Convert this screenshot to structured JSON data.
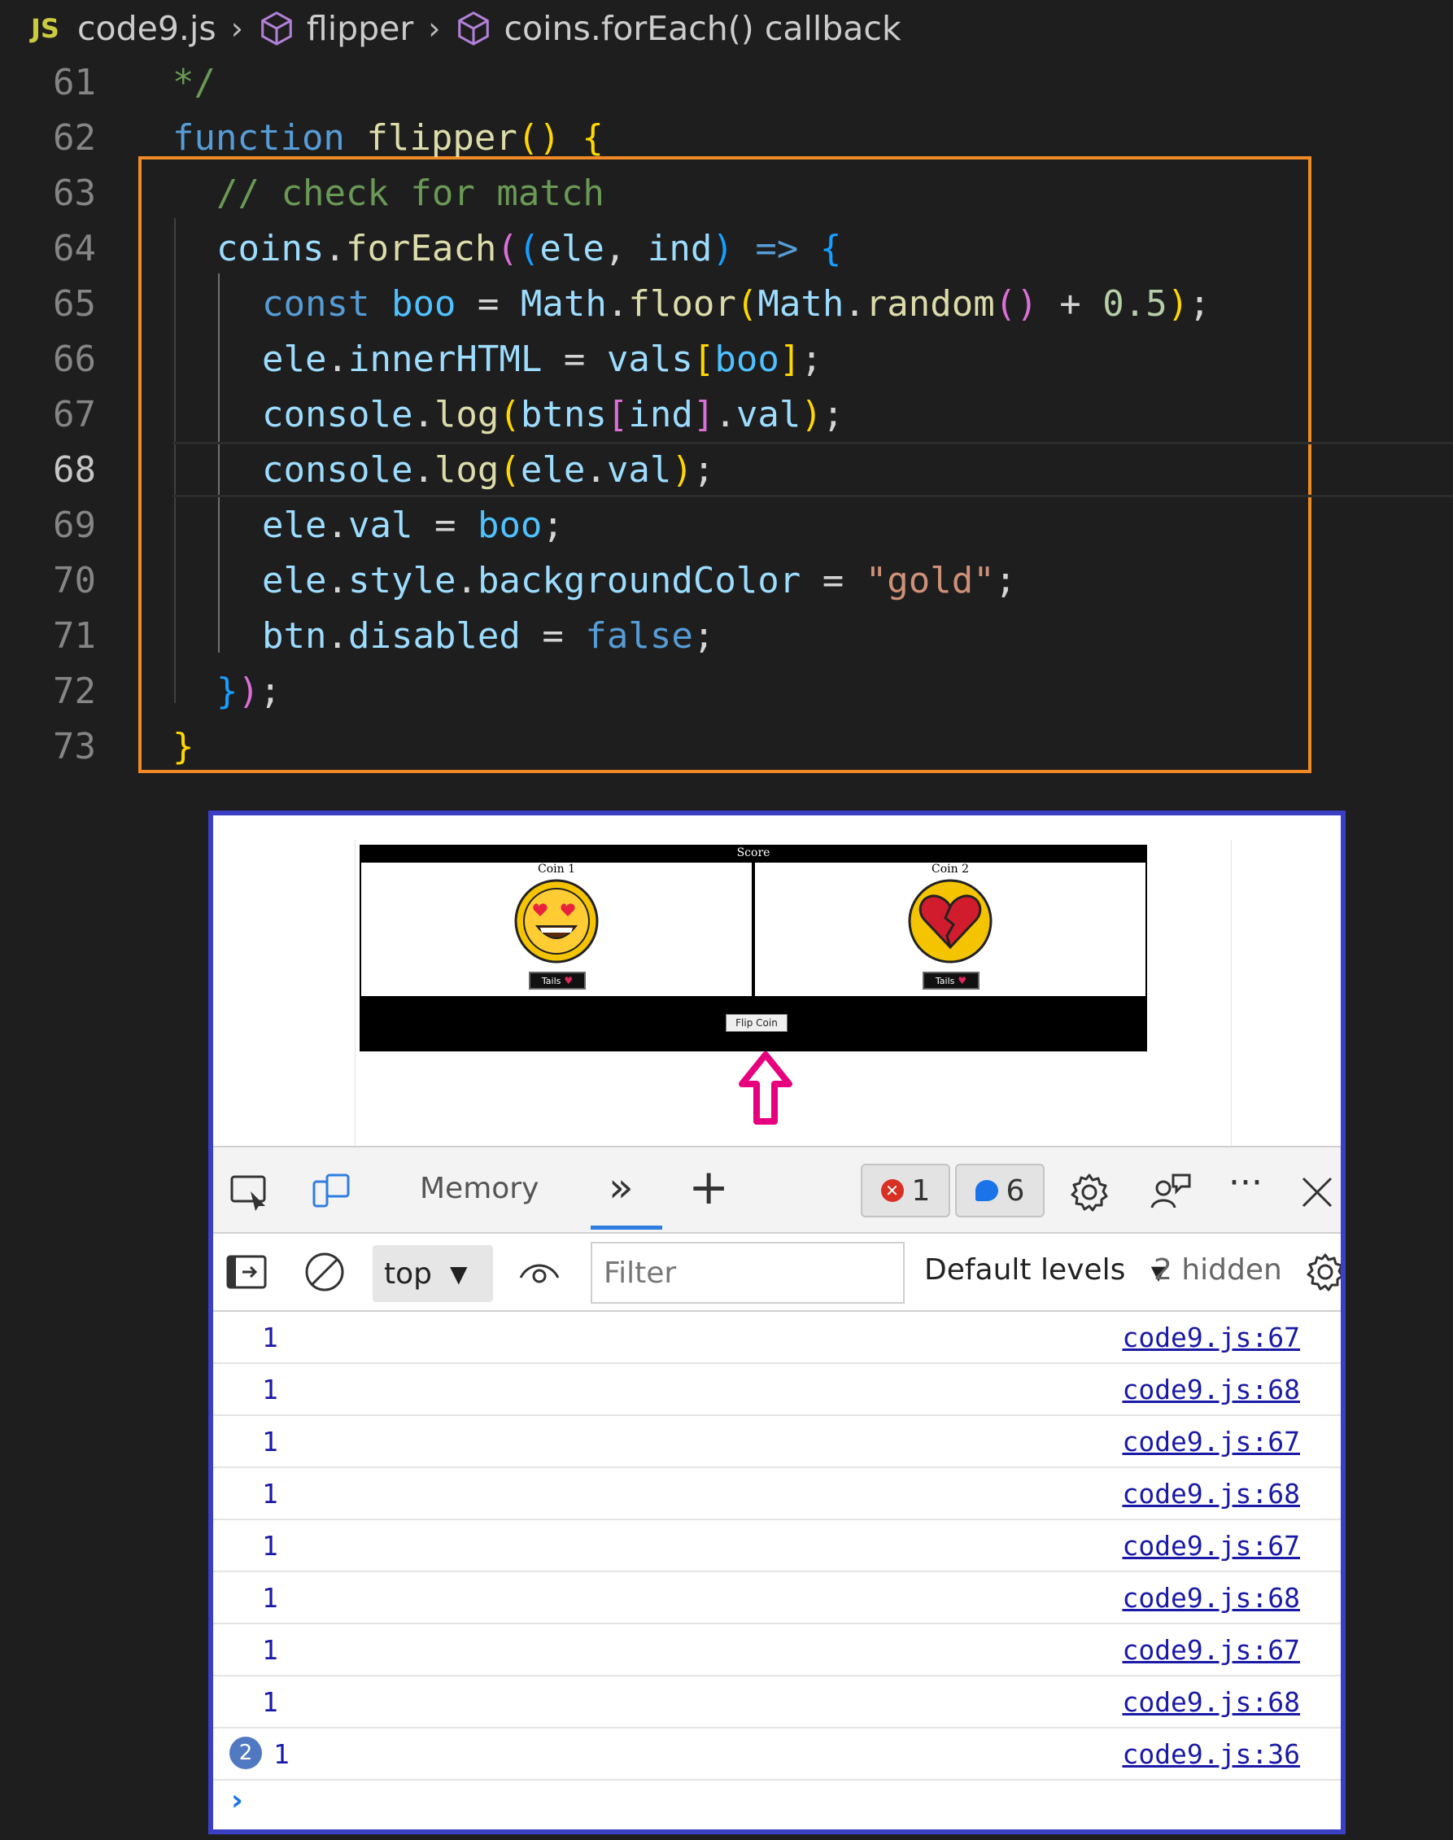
{
  "breadcrumb": {
    "file_badge": "JS",
    "file": "code9.js",
    "symbol1": "flipper",
    "symbol2": "coins.forEach() callback"
  },
  "code": {
    "line_numbers": [
      "61",
      "62",
      "63",
      "64",
      "65",
      "66",
      "67",
      "68",
      "69",
      "70",
      "71",
      "72",
      "73"
    ],
    "current_line": "68",
    "lines": [
      "*/",
      "function flipper() {",
      "// check for match",
      "coins.forEach((ele, ind) => {",
      "const boo = Math.floor(Math.random() + 0.5);",
      "ele.innerHTML = vals[boo];",
      "console.log(btns[ind].val);",
      "console.log(ele.val);",
      "ele.val = boo;",
      "ele.style.backgroundColor = \"gold\";",
      "btn.disabled = false;",
      "});",
      "}"
    ],
    "highlight_color": "#f08a24"
  },
  "page": {
    "score_title": "Score",
    "coin1_title": "Coin 1",
    "coin2_title": "Coin 2",
    "coin1_btn": "Tails",
    "coin2_btn": "Tails",
    "flip_button": "Flip Coin",
    "arrow_color": "#e6007e"
  },
  "devtools": {
    "tab_memory": "Memory",
    "more_tabs": "»",
    "add_tab": "+",
    "error_count": "1",
    "message_count": "6",
    "context": "top",
    "filter_placeholder": "Filter",
    "levels": "Default levels",
    "hidden": "2 hidden",
    "panel_border_color": "#3b3fc4"
  },
  "console": {
    "rows": [
      {
        "value": "1",
        "source": "code9.js:67"
      },
      {
        "value": "1",
        "source": "code9.js:68"
      },
      {
        "value": "1",
        "source": "code9.js:67"
      },
      {
        "value": "1",
        "source": "code9.js:68"
      },
      {
        "value": "1",
        "source": "code9.js:67"
      },
      {
        "value": "1",
        "source": "code9.js:68"
      },
      {
        "value": "1",
        "source": "code9.js:67"
      },
      {
        "value": "1",
        "source": "code9.js:68"
      },
      {
        "value": "1",
        "source": "code9.js:36",
        "repeat": "2"
      }
    ],
    "prompt": "›"
  }
}
